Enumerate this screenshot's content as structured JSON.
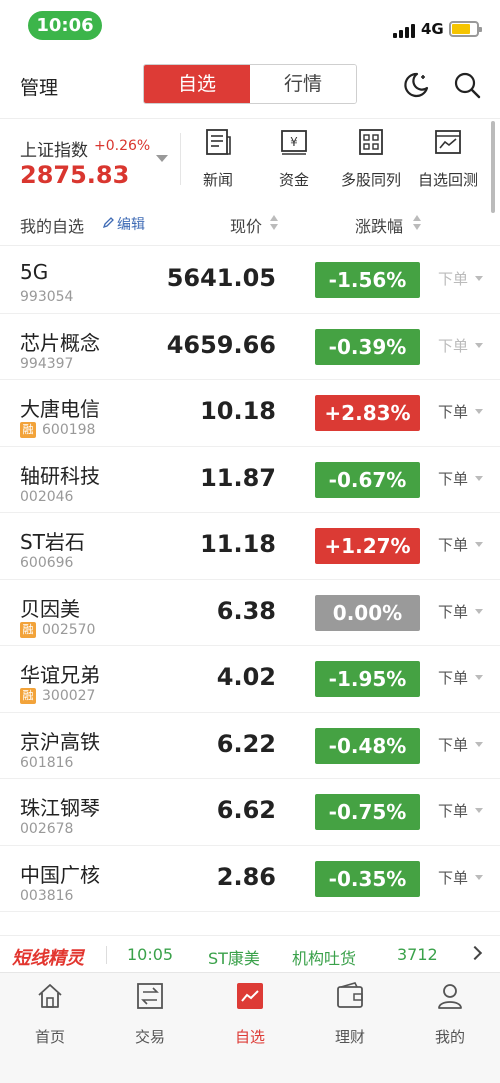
{
  "status_bar": {
    "time": "10:06",
    "network": "4G"
  },
  "header": {
    "left_label": "管理",
    "tabs": [
      {
        "label": "自选",
        "active": true
      },
      {
        "label": "行情",
        "active": false
      }
    ],
    "icons": [
      "night-mode-icon",
      "search-icon"
    ]
  },
  "index": {
    "name": "上证指数",
    "change_pct": "+0.26%",
    "value": "2875.83",
    "color": "#d9362f"
  },
  "quick_links": [
    {
      "label": "新闻",
      "icon": "news-icon"
    },
    {
      "label": "资金",
      "icon": "fund-flow-icon"
    },
    {
      "label": "多股同列",
      "icon": "grid-icon"
    },
    {
      "label": "自选回测",
      "icon": "backtest-icon"
    }
  ],
  "list_header": {
    "mine": "我的自选",
    "edit": "编辑",
    "price": "现价",
    "change": "涨跌幅"
  },
  "colors": {
    "up": "#db3a34",
    "down": "#45a243",
    "flat": "#9a9a9a",
    "accent": "#dd3b36"
  },
  "stocks": [
    {
      "name": "5G",
      "code": "993054",
      "rong": false,
      "price": "5641.05",
      "change": "-1.56%",
      "trend": "down",
      "order": "下单",
      "order_dim": true
    },
    {
      "name": "芯片概念",
      "code": "994397",
      "rong": false,
      "price": "4659.66",
      "change": "-0.39%",
      "trend": "down",
      "order": "下单",
      "order_dim": true
    },
    {
      "name": "大唐电信",
      "code": "600198",
      "rong": true,
      "price": "10.18",
      "change": "+2.83%",
      "trend": "up",
      "order": "下单",
      "order_dim": false
    },
    {
      "name": "轴研科技",
      "code": "002046",
      "rong": false,
      "price": "11.87",
      "change": "-0.67%",
      "trend": "down",
      "order": "下单",
      "order_dim": false
    },
    {
      "name": "ST岩石",
      "code": "600696",
      "rong": false,
      "price": "11.18",
      "change": "+1.27%",
      "trend": "up",
      "order": "下单",
      "order_dim": false
    },
    {
      "name": "贝因美",
      "code": "002570",
      "rong": true,
      "price": "6.38",
      "change": "0.00%",
      "trend": "flat",
      "order": "下单",
      "order_dim": false
    },
    {
      "name": "华谊兄弟",
      "code": "300027",
      "rong": true,
      "price": "4.02",
      "change": "-1.95%",
      "trend": "down",
      "order": "下单",
      "order_dim": false
    },
    {
      "name": "京沪高铁",
      "code": "601816",
      "rong": false,
      "price": "6.22",
      "change": "-0.48%",
      "trend": "down",
      "order": "下单",
      "order_dim": false
    },
    {
      "name": "珠江钢琴",
      "code": "002678",
      "rong": false,
      "price": "6.62",
      "change": "-0.75%",
      "trend": "down",
      "order": "下单",
      "order_dim": false
    },
    {
      "name": "中国广核",
      "code": "003816",
      "rong": false,
      "price": "2.86",
      "change": "-0.35%",
      "trend": "down",
      "order": "下单",
      "order_dim": false
    }
  ],
  "rong_label": "融",
  "ticker": {
    "brand": "短线精灵",
    "time": "10:05",
    "stock": "ST康美",
    "event": "机构吐货",
    "volume": "3712"
  },
  "tabbar": [
    {
      "label": "首页",
      "icon": "home-icon",
      "active": false
    },
    {
      "label": "交易",
      "icon": "trade-icon",
      "active": false
    },
    {
      "label": "自选",
      "icon": "watchlist-chart-icon",
      "active": true
    },
    {
      "label": "理财",
      "icon": "wallet-icon",
      "active": false
    },
    {
      "label": "我的",
      "icon": "profile-icon",
      "active": false
    }
  ]
}
